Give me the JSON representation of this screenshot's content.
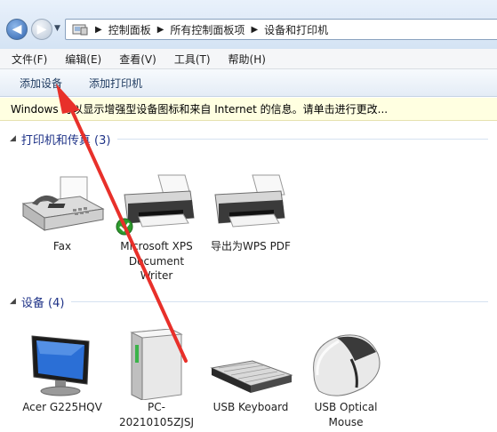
{
  "address_bar": {
    "breadcrumbs": [
      "控制面板",
      "所有控制面板项",
      "设备和打印机"
    ],
    "icon": "control-panel-icon"
  },
  "menu": [
    "文件(F)",
    "编辑(E)",
    "查看(V)",
    "工具(T)",
    "帮助(H)"
  ],
  "commands": {
    "add_device": "添加设备",
    "add_printer": "添加打印机"
  },
  "info_bar": "Windows 可以显示增强型设备图标和来自 Internet 的信息。请单击进行更改...",
  "groups": {
    "printers": {
      "title": "打印机和传真 (3)",
      "items": [
        {
          "label": "Fax",
          "icon": "fax-icon"
        },
        {
          "label": "Microsoft XPS Document Writer",
          "icon": "printer-icon",
          "default": true
        },
        {
          "label": "导出为WPS PDF",
          "icon": "printer-icon"
        }
      ]
    },
    "devices": {
      "title": "设备 (4)",
      "items": [
        {
          "label": "Acer G225HQV",
          "icon": "monitor-icon"
        },
        {
          "label": "PC-20210105ZJSJ",
          "icon": "computer-tower-icon"
        },
        {
          "label": "USB Keyboard",
          "icon": "keyboard-icon"
        },
        {
          "label": "USB Optical Mouse",
          "icon": "mouse-icon"
        }
      ]
    }
  },
  "colors": {
    "group_title": "#1e3287",
    "info_bar_bg": "#ffffe1",
    "annotation_arrow": "#e8302a",
    "default_check": "#2e9b2e"
  }
}
